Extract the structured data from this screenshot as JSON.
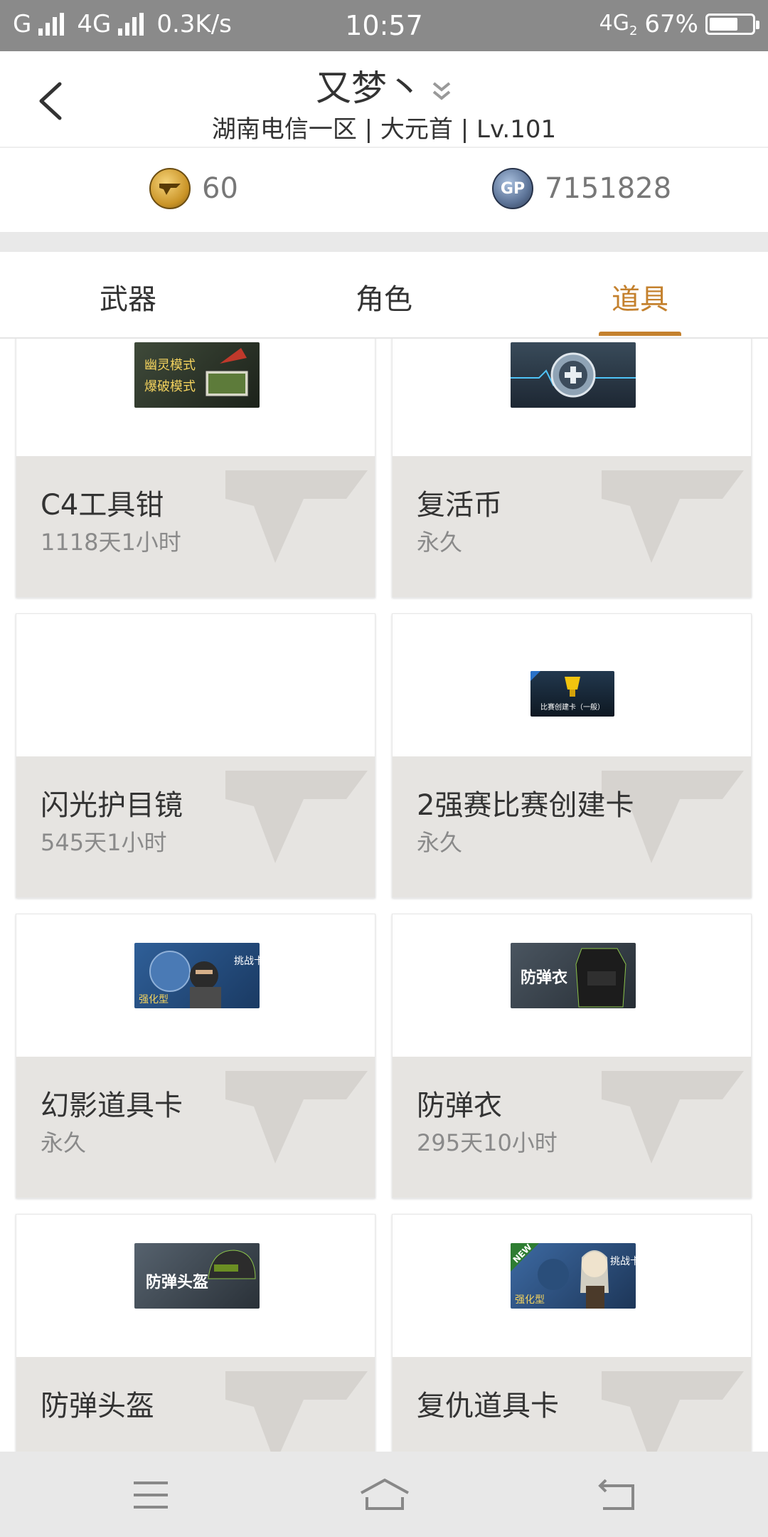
{
  "status_bar": {
    "left": "G",
    "network": "4G",
    "speed": "0.3K/s",
    "time": "10:57",
    "network_right": "4G",
    "network_right_sub": "2",
    "battery": "67%",
    "battery_level": 0.67
  },
  "header": {
    "title": "又梦丶",
    "subtitle": "湖南电信一区 | 大元首 | Lv.101"
  },
  "currency": {
    "cf_icon": "cf-coin-icon",
    "cf_value": "60",
    "gp_label": "GP",
    "gp_value": "7151828"
  },
  "tabs": [
    {
      "label": "武器",
      "active": false
    },
    {
      "label": "角色",
      "active": false
    },
    {
      "label": "道具",
      "active": true
    }
  ],
  "items": [
    {
      "name": "C4工具钳",
      "duration": "1118天1小时",
      "image_text": [
        "幽灵模式",
        "爆破模式"
      ],
      "image": "c4-pliers-image"
    },
    {
      "name": "复活币",
      "duration": "永久",
      "image": "revive-coin-image"
    },
    {
      "name": "闪光护目镜",
      "duration": "545天1小时",
      "image": null
    },
    {
      "name": "2强赛比赛创建卡",
      "duration": "永久",
      "image_text": [
        "比赛创建卡（一般）"
      ],
      "image": "match-card-image"
    },
    {
      "name": "幻影道具卡",
      "duration": "永久",
      "image_text": [
        "强化型",
        "挑战卡"
      ],
      "image": "phantom-card-image"
    },
    {
      "name": "防弹衣",
      "duration": "295天10小时",
      "image_text": [
        "防弹衣"
      ],
      "image": "vest-image"
    },
    {
      "name": "防弹头盔",
      "duration": "",
      "image_text": [
        "防弹头盔"
      ],
      "image": "helmet-image"
    },
    {
      "name": "复仇道具卡",
      "duration": "",
      "image_text": [
        "NEW",
        "强化型",
        "挑战卡"
      ],
      "image": "revenge-card-image"
    }
  ],
  "nav": {
    "menu": "menu-icon",
    "home": "home-icon",
    "back": "back-icon"
  },
  "colors": {
    "accent": "#c4812e",
    "status_bar": "#8a8a8a",
    "card_info_bg": "#e6e4e1"
  }
}
